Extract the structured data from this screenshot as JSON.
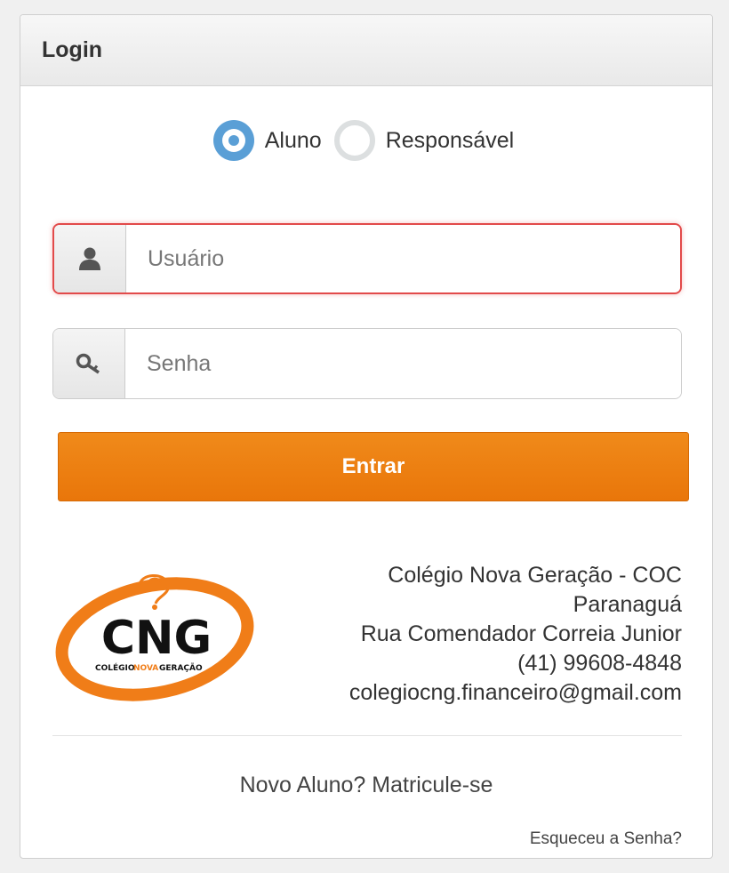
{
  "panel": {
    "title": "Login"
  },
  "user_type": {
    "options": [
      {
        "label": "Aluno",
        "checked": true
      },
      {
        "label": "Responsável",
        "checked": false
      }
    ]
  },
  "form": {
    "username": {
      "value": "",
      "placeholder": "Usuário",
      "icon": "user-icon",
      "state": "error"
    },
    "password": {
      "value": "",
      "placeholder": "Senha",
      "icon": "key-icon"
    },
    "submit_label": "Entrar"
  },
  "logo": {
    "text": "CNG",
    "tagline_parts": [
      "COLÉGIO",
      "NOVA",
      "GERAÇÃO"
    ]
  },
  "school": {
    "name": "Colégio Nova Geração - COC",
    "city": "Paranaguá",
    "address": "Rua Comendador Correia Junior",
    "phone": "(41) 99608-4848",
    "email": "colegiocng.financeiro@gmail.com"
  },
  "links": {
    "register": "Novo Aluno? Matricule-se",
    "forgot_password": "Esqueceu a Senha?"
  },
  "colors": {
    "accent": "#f08a1a",
    "radio_checked": "#5a9fd6",
    "error_border": "#e24a4a",
    "logo_orange": "#f07d18"
  }
}
